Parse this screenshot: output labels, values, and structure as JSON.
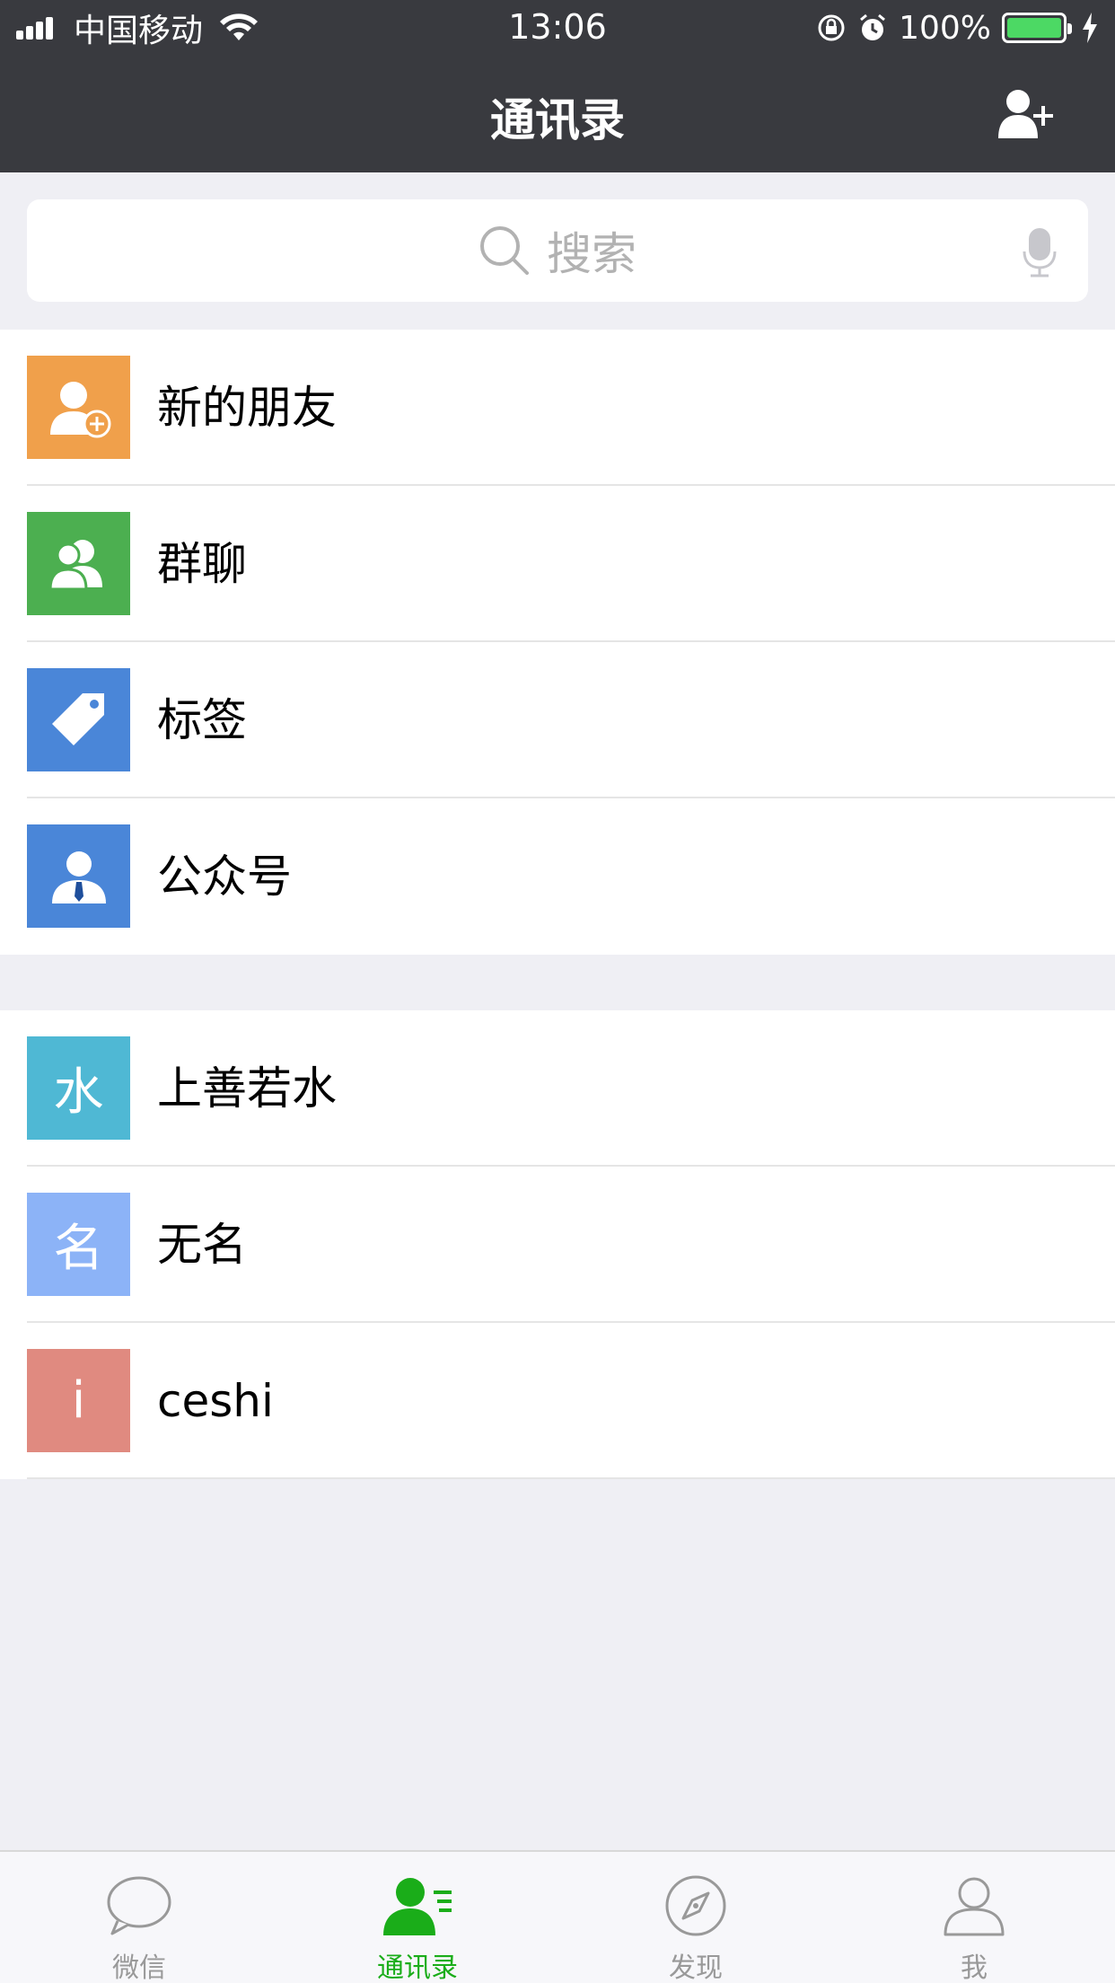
{
  "status_bar": {
    "carrier": "中国移动",
    "time": "13:06",
    "battery": "100%"
  },
  "nav": {
    "title": "通讯录"
  },
  "search": {
    "placeholder": "搜索"
  },
  "functions": [
    {
      "label": "新的朋友",
      "icon": "new-friend-icon",
      "color": "#f0a04b"
    },
    {
      "label": "群聊",
      "icon": "group-chat-icon",
      "color": "#4caf50"
    },
    {
      "label": "标签",
      "icon": "tag-icon",
      "color": "#4a86d8"
    },
    {
      "label": "公众号",
      "icon": "official-account-icon",
      "color": "#4a86d8"
    }
  ],
  "contacts": [
    {
      "name": "上善若水",
      "initial": "水",
      "color": "#4fb8d4"
    },
    {
      "name": "无名",
      "initial": "名",
      "color": "#8cb3f7"
    },
    {
      "name": "ceshi",
      "initial": "i",
      "color": "#e08a80"
    }
  ],
  "tabbar": {
    "tabs": [
      {
        "label": "微信",
        "icon": "chat-bubble-icon",
        "active": false
      },
      {
        "label": "通讯录",
        "icon": "contacts-icon",
        "active": true
      },
      {
        "label": "发现",
        "icon": "compass-icon",
        "active": false
      },
      {
        "label": "我",
        "icon": "profile-icon",
        "active": false
      }
    ],
    "active_color": "#1aad19",
    "inactive_color": "#999999"
  }
}
